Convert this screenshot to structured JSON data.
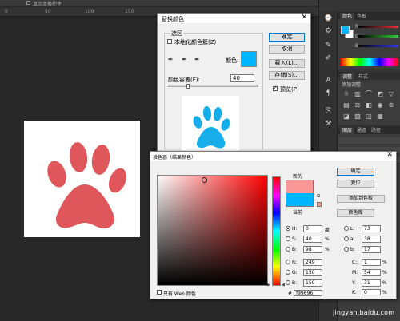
{
  "topbar": {
    "checkbox_label": "显示变换控件"
  },
  "ruler": {
    "ticks": [
      "0",
      "50",
      "100",
      "150"
    ]
  },
  "right_panel": {
    "color_tabs": [
      "颜色",
      "色板"
    ],
    "adjust_tabs": [
      "调整",
      "样式"
    ],
    "adjust_subtitle": "添加调整",
    "layers_tabs": [
      "图层",
      "通道",
      "路径"
    ],
    "sliders": [
      {
        "label": "R",
        "color": "#e33"
      },
      {
        "label": "G",
        "color": "#3c3"
      },
      {
        "label": "B",
        "color": "#33f"
      }
    ]
  },
  "replace_color": {
    "title": "替换颜色",
    "group_label": "选区",
    "localized_label": "本地化颜色簇(Z)",
    "color_label": "颜色:",
    "fuzziness_label": "颜色容差(F):",
    "fuzziness_value": "40",
    "fuzziness": 40,
    "buttons": {
      "ok": "确定",
      "cancel": "取消",
      "load": "载入(L)...",
      "save": "存储(S)..."
    },
    "preview_label": "预览(P)",
    "preview_checked": true,
    "color_swatch": "#00b4ff"
  },
  "color_picker": {
    "title": "拾色器（结果颜色）",
    "new_label": "新的",
    "current_label": "当前",
    "buttons": {
      "ok": "确定",
      "reset": "复位",
      "add_swatch": "添加到色板",
      "libraries": "颜色库"
    },
    "web_only_label": "只有 Web 颜色",
    "hsb": [
      {
        "label": "H:",
        "value": "0",
        "unit": "度",
        "selected": true
      },
      {
        "label": "S:",
        "value": "40",
        "unit": "%",
        "selected": false
      },
      {
        "label": "B:",
        "value": "98",
        "unit": "%",
        "selected": false
      }
    ],
    "rgb": [
      {
        "label": "R:",
        "value": "249"
      },
      {
        "label": "G:",
        "value": "150"
      },
      {
        "label": "B:",
        "value": "150"
      }
    ],
    "lab": [
      {
        "label": "L:",
        "value": "73"
      },
      {
        "label": "a:",
        "value": "38"
      },
      {
        "label": "b:",
        "value": "17"
      }
    ],
    "cmyk": [
      {
        "label": "C:",
        "value": "1",
        "unit": "%"
      },
      {
        "label": "M:",
        "value": "54",
        "unit": "%"
      },
      {
        "label": "Y:",
        "value": "31",
        "unit": "%"
      },
      {
        "label": "K:",
        "value": "0",
        "unit": "%"
      }
    ],
    "hex_label": "#",
    "hex_value": "f99696",
    "new_color": "#f99696",
    "current_color": "#00b4ff"
  },
  "watermark": "jingyan.baidu.com"
}
